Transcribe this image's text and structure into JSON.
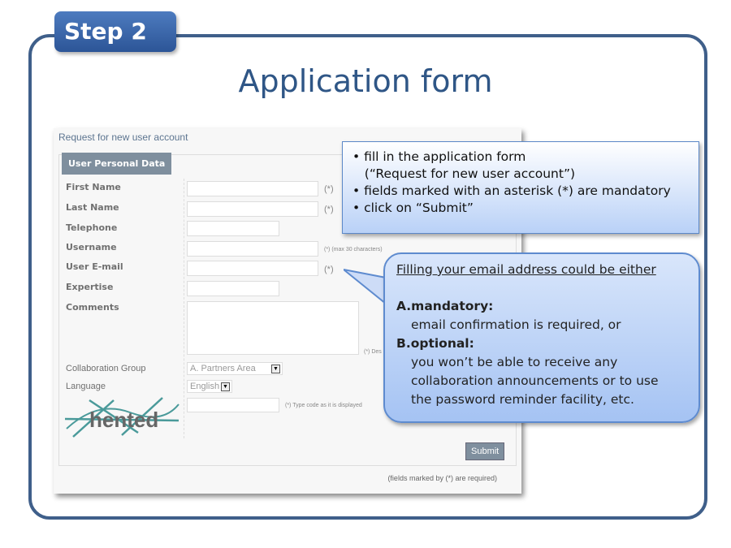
{
  "step": "Step 2",
  "title": "Application form",
  "form": {
    "heading": "Request for new user account",
    "legend": "User Personal Data",
    "fields": [
      {
        "label": "First Name",
        "note": "(*)"
      },
      {
        "label": "Last Name",
        "note": "(*)"
      },
      {
        "label": "Telephone",
        "note": ""
      },
      {
        "label": "Username",
        "note": "(*) (max 30 characters)"
      },
      {
        "label": "User E-mail",
        "note": "(*)"
      },
      {
        "label": "Expertise",
        "note": ""
      },
      {
        "label": "Comments",
        "note": "(*) Des"
      },
      {
        "label": "Collaboration Group",
        "value": "A. Partners Area"
      },
      {
        "label": "Language",
        "value": "English"
      }
    ],
    "captcha_text": "hented",
    "captcha_note": "(*) Type code as it is displayed",
    "submit": "Submit",
    "footer": "(fields marked by (*) are required)"
  },
  "callout1": [
    "• fill in the application form",
    "   (“Request for new user account”)",
    "• fields marked with an asterisk (*) are mandatory",
    "• click on “Submit”"
  ],
  "callout2": {
    "title": "Filling your email address could be either",
    "a_label": "A.mandatory:",
    "a_text": "email confirmation is required, or",
    "b_label": "B.optional:",
    "b_text": [
      "you won’t be able to receive any",
      "collaboration announcements or to use",
      "the password reminder facility, etc."
    ]
  }
}
